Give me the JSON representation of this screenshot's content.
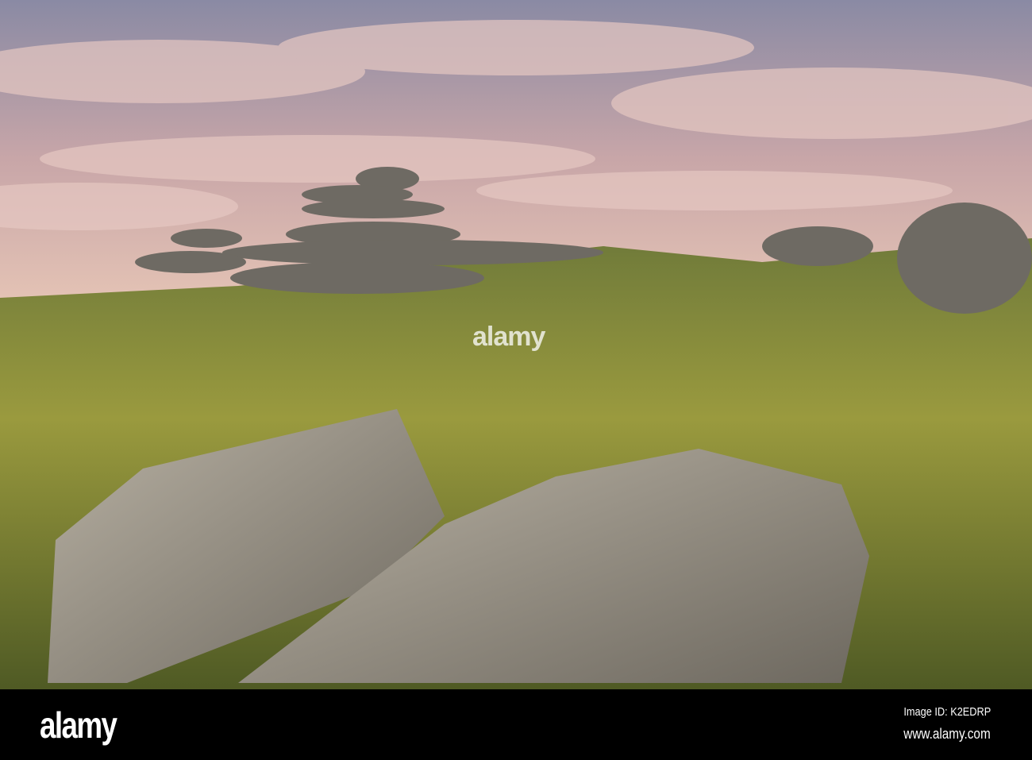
{
  "photo": {
    "subject": "granite tors on moorland grass at sunset"
  },
  "watermark": {
    "logo": "alamy",
    "image_id": "Image ID: K2EDRP",
    "url": "www.alamy.com"
  },
  "colors": {
    "sky_top": "#8d8fa8",
    "cloud": "#d9b8b4",
    "grass": "#7d8a34",
    "rock": "#9a958a",
    "footer": "#000000"
  }
}
